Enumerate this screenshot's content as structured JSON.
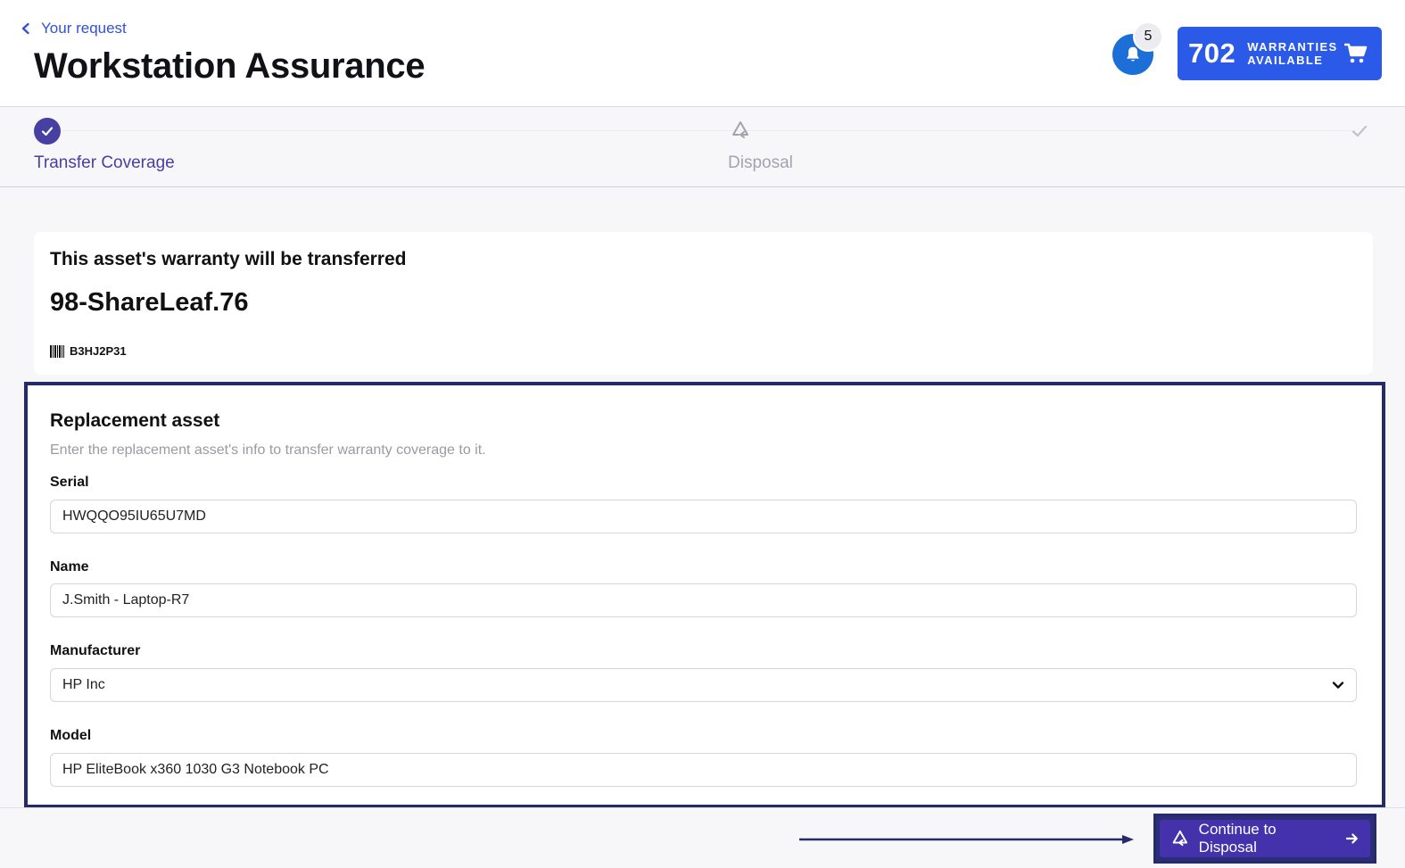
{
  "header": {
    "back_label": "Your request",
    "title": "Workstation Assurance",
    "notification_count": "5",
    "warranty_count": "702",
    "warranty_label": "WARRANTIES AVAILABLE"
  },
  "stepper": {
    "steps": [
      {
        "label": "Transfer Coverage",
        "state": "complete",
        "icon": "check-icon"
      },
      {
        "label": "Disposal",
        "state": "upcoming",
        "icon": "recycle-icon"
      },
      {
        "label": "",
        "state": "upcoming",
        "icon": "check-icon"
      }
    ]
  },
  "asset": {
    "heading": "This asset's warranty will be transferred",
    "name": "98-ShareLeaf.76",
    "tag": "B3HJ2P31"
  },
  "replacement": {
    "heading": "Replacement asset",
    "help": "Enter the replacement asset's info to transfer warranty coverage to it.",
    "serial_label": "Serial",
    "serial_value": "HWQQO95IU65U7MD",
    "name_label": "Name",
    "name_value": "J.Smith - Laptop-R7",
    "manufacturer_label": "Manufacturer",
    "manufacturer_value": "HP Inc",
    "model_label": "Model",
    "model_value": "HP EliteBook x360 1030 G3 Notebook PC"
  },
  "footer": {
    "continue_label": "Continue to Disposal"
  },
  "colors": {
    "accent": "#473fa2",
    "primary_button": "#4332ab",
    "warranty_button": "#2b59e8",
    "notification": "#1d6fd8",
    "link": "#2f52d6",
    "highlight_border": "#252a6a"
  }
}
